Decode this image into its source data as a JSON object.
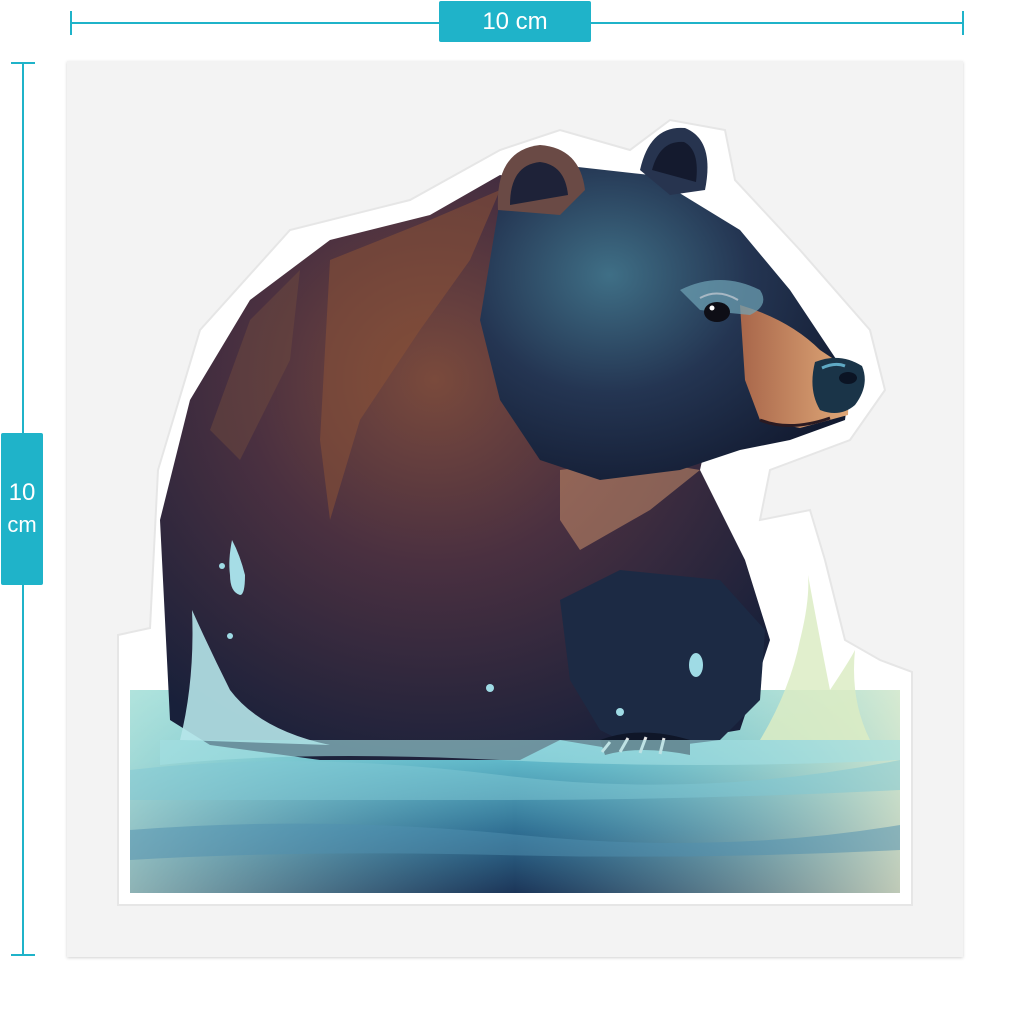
{
  "width_label": "10 cm",
  "height_label": {
    "value": "10",
    "unit": "cm"
  },
  "colors": {
    "accent": "#1fb3c9",
    "sheet": "#f3f3f3"
  }
}
